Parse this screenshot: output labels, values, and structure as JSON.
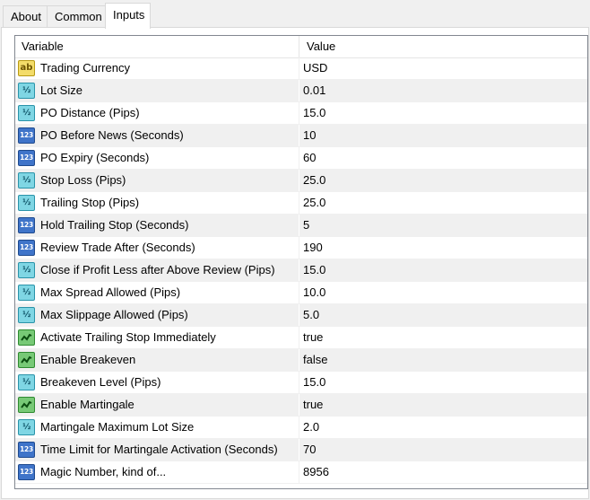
{
  "tabs": [
    {
      "label": "About",
      "active": false
    },
    {
      "label": "Common",
      "active": false
    },
    {
      "label": "Inputs",
      "active": true
    }
  ],
  "grid": {
    "columns": {
      "variable": "Variable",
      "value": "Value"
    },
    "rows": [
      {
        "type": "text",
        "icon": "text-type-icon",
        "icon_label": "ab",
        "name": "Trading Currency",
        "value": "USD"
      },
      {
        "type": "double",
        "icon": "double-type-icon",
        "icon_label": "½",
        "name": "Lot Size",
        "value": "0.01"
      },
      {
        "type": "double",
        "icon": "double-type-icon",
        "icon_label": "½",
        "name": "PO Distance (Pips)",
        "value": "15.0"
      },
      {
        "type": "int",
        "icon": "integer-type-icon",
        "icon_label": "123",
        "name": "PO Before News (Seconds)",
        "value": "10"
      },
      {
        "type": "int",
        "icon": "integer-type-icon",
        "icon_label": "123",
        "name": "PO Expiry (Seconds)",
        "value": "60"
      },
      {
        "type": "double",
        "icon": "double-type-icon",
        "icon_label": "½",
        "name": "Stop Loss  (Pips)",
        "value": "25.0"
      },
      {
        "type": "double",
        "icon": "double-type-icon",
        "icon_label": "½",
        "name": "Trailing Stop (Pips)",
        "value": "25.0"
      },
      {
        "type": "int",
        "icon": "integer-type-icon",
        "icon_label": "123",
        "name": "Hold Trailing Stop (Seconds)",
        "value": "5"
      },
      {
        "type": "int",
        "icon": "integer-type-icon",
        "icon_label": "123",
        "name": "Review Trade After (Seconds)",
        "value": "190"
      },
      {
        "type": "double",
        "icon": "double-type-icon",
        "icon_label": "½",
        "name": "Close if Profit Less after Above Review (Pips)",
        "value": "15.0"
      },
      {
        "type": "double",
        "icon": "double-type-icon",
        "icon_label": "½",
        "name": "Max Spread Allowed (Pips)",
        "value": "10.0"
      },
      {
        "type": "double",
        "icon": "double-type-icon",
        "icon_label": "½",
        "name": "Max Slippage Allowed (Pips)",
        "value": "5.0"
      },
      {
        "type": "bool",
        "icon": "boolean-type-icon",
        "icon_label": "",
        "name": "Activate Trailing Stop Immediately",
        "value": "true"
      },
      {
        "type": "bool",
        "icon": "boolean-type-icon",
        "icon_label": "",
        "name": "Enable Breakeven",
        "value": "false"
      },
      {
        "type": "double",
        "icon": "double-type-icon",
        "icon_label": "½",
        "name": "Breakeven Level (Pips)",
        "value": "15.0"
      },
      {
        "type": "bool",
        "icon": "boolean-type-icon",
        "icon_label": "",
        "name": "Enable Martingale",
        "value": "true"
      },
      {
        "type": "double",
        "icon": "double-type-icon",
        "icon_label": "½",
        "name": "Martingale Maximum Lot Size",
        "value": "2.0"
      },
      {
        "type": "int",
        "icon": "integer-type-icon",
        "icon_label": "123",
        "name": "Time Limit for Martingale Activation (Seconds)",
        "value": "70"
      },
      {
        "type": "int",
        "icon": "integer-type-icon",
        "icon_label": "123",
        "name": "Magic Number, kind of...",
        "value": "8956"
      }
    ]
  }
}
